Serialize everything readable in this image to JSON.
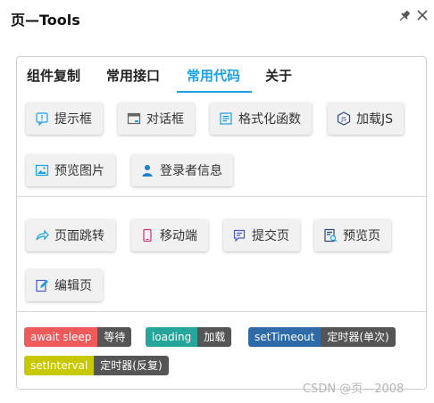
{
  "window": {
    "title": "页—Tools",
    "pin_icon": "pin-icon",
    "close_icon": "close-icon"
  },
  "tabs": [
    {
      "label": "组件复制"
    },
    {
      "label": "常用接口"
    },
    {
      "label": "常用代码",
      "active": true
    },
    {
      "label": "关于"
    }
  ],
  "accent_color": "#1ba1e2",
  "group1": {
    "buttons": [
      {
        "label": "提示框",
        "icon": "alert-icon"
      },
      {
        "label": "对话框",
        "icon": "dialog-icon"
      },
      {
        "label": "格式化函数",
        "icon": "format-icon"
      },
      {
        "label": "加载JS",
        "icon": "js-icon"
      },
      {
        "label": "预览图片",
        "icon": "image-icon"
      },
      {
        "label": "登录者信息",
        "icon": "user-icon"
      }
    ]
  },
  "group2": {
    "buttons": [
      {
        "label": "页面跳转",
        "icon": "redirect-icon"
      },
      {
        "label": "移动端",
        "icon": "mobile-icon"
      },
      {
        "label": "提交页",
        "icon": "submit-icon"
      },
      {
        "label": "预览页",
        "icon": "preview-page-icon"
      },
      {
        "label": "编辑页",
        "icon": "edit-icon"
      }
    ]
  },
  "snippets": [
    {
      "key": "await sleep",
      "value": "等待",
      "color": "#f05a5a"
    },
    {
      "key": "loading",
      "value": "加载",
      "color": "#26a59a"
    },
    {
      "key": "setTimeout",
      "value": "定时器(单次)",
      "color": "#2f6ba8"
    },
    {
      "key": "setInterval",
      "value": "定时器(反复)",
      "color": "#c8c800"
    }
  ],
  "watermark": "CSDN @页—2008"
}
